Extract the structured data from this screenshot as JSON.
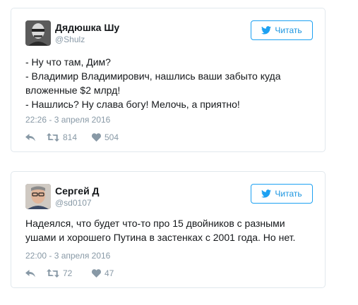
{
  "tweets": [
    {
      "author": {
        "name": "Дядюшка Шу",
        "handle": "@Shulz"
      },
      "follow_label": "Читать",
      "text": "- Ну что там, Дим?\n- Владимир Владимирович, нашлись ваши забыто куда вложенные $2 млрд!\n- Нашлись? Ну слава богу! Мелочь, а приятно!",
      "timestamp": "22:26 - 3 апреля 2016",
      "retweets": "814",
      "likes": "504"
    },
    {
      "author": {
        "name": "Сергей Д",
        "handle": "@sd0107"
      },
      "follow_label": "Читать",
      "text": "Надеялся, что будет что-то про 15 двойников с разными ушами и хорошего Путина в застенках с 2001 года. Но нет.",
      "timestamp": "22:00 - 3 апреля 2016",
      "retweets": "72",
      "likes": "47"
    }
  ],
  "colors": {
    "accent": "#1da1f2",
    "muted": "#8899a6",
    "border": "#e1e8ed"
  },
  "icons": [
    "twitter-bird-icon",
    "reply-icon",
    "retweet-icon",
    "heart-icon"
  ]
}
